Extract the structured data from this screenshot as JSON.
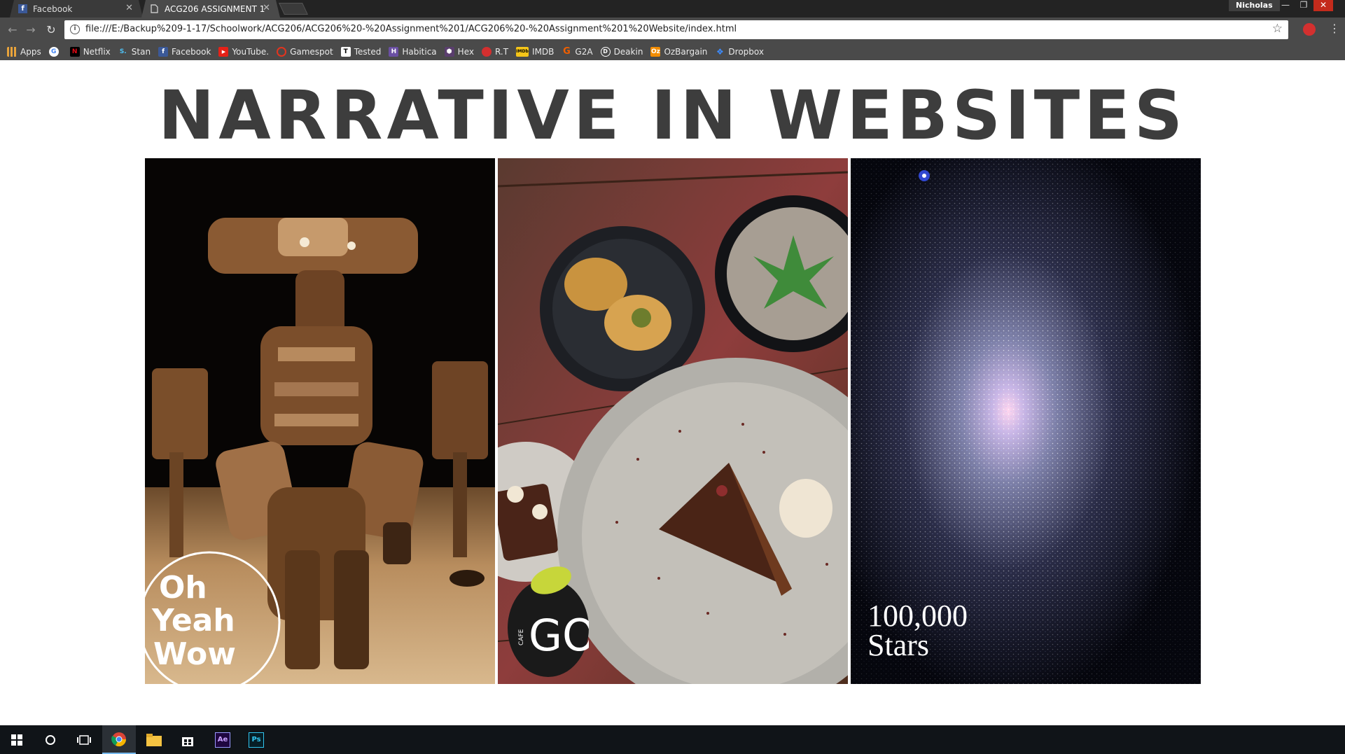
{
  "browser": {
    "tabs": [
      {
        "label": "Facebook",
        "icon": "facebook-icon",
        "active": false
      },
      {
        "label": "ACG206 ASSIGNMENT 1",
        "icon": "document-icon",
        "active": true
      }
    ],
    "profile_name": "Nicholas",
    "url": "file:///E:/Backup%209-1-17/Schoolwork/ACG206/ACG206%20-%20Assignment%201/ACG206%20-%20Assignment%201%20Website/index.html",
    "bookmarks": [
      {
        "label": "Apps",
        "icon": "apps-grid-icon",
        "color": "#e8a33b"
      },
      {
        "label": "",
        "icon": "google-icon",
        "color": "#ffffff"
      },
      {
        "label": "Netflix",
        "icon": "netflix-icon",
        "color": "#e50914"
      },
      {
        "label": "Stan",
        "icon": "stan-icon",
        "color": "#1e88e5"
      },
      {
        "label": "Facebook",
        "icon": "facebook-icon",
        "color": "#3b5998"
      },
      {
        "label": "YouTube.",
        "icon": "youtube-icon",
        "color": "#e62117"
      },
      {
        "label": "Gamespot",
        "icon": "gamespot-icon",
        "color": "#e3341e"
      },
      {
        "label": "Tested",
        "icon": "tested-icon",
        "color": "#ffffff"
      },
      {
        "label": "Habitica",
        "icon": "habitica-icon",
        "color": "#6a4fa3"
      },
      {
        "label": "Hex",
        "icon": "hex-icon",
        "color": "#5a3e6e"
      },
      {
        "label": "R.T",
        "icon": "tomato-icon",
        "color": "#d32f2f"
      },
      {
        "label": "IMDB",
        "icon": "imdb-icon",
        "color": "#f5c518"
      },
      {
        "label": "G2A",
        "icon": "g2a-icon",
        "color": "#f05f00"
      },
      {
        "label": "Deakin",
        "icon": "deakin-icon",
        "color": "#ffffff"
      },
      {
        "label": "OzBargain",
        "icon": "ozbargain-icon",
        "color": "#f28c00"
      },
      {
        "label": "Dropbox",
        "icon": "dropbox-icon",
        "color": "#0061fe"
      }
    ]
  },
  "page": {
    "title": "NARRATIVE IN WEBSITES",
    "panels": [
      {
        "name": "oh-yeah-wow-panel",
        "logo_text": "Oh Yeah Wow"
      },
      {
        "name": "cafe-go-panel",
        "logo_text": "GO",
        "logo_small": "CAFE"
      },
      {
        "name": "stars-panel",
        "label_line1": "100,000",
        "label_line2": "Stars"
      }
    ]
  },
  "taskbar": {
    "items": [
      {
        "icon": "windows-start-icon"
      },
      {
        "icon": "cortana-search-icon"
      },
      {
        "icon": "task-view-icon"
      },
      {
        "icon": "chrome-icon"
      },
      {
        "icon": "file-explorer-icon"
      },
      {
        "icon": "store-icon"
      },
      {
        "icon": "after-effects-icon",
        "label": "Ae"
      },
      {
        "icon": "photoshop-icon",
        "label": "Ps"
      }
    ]
  }
}
